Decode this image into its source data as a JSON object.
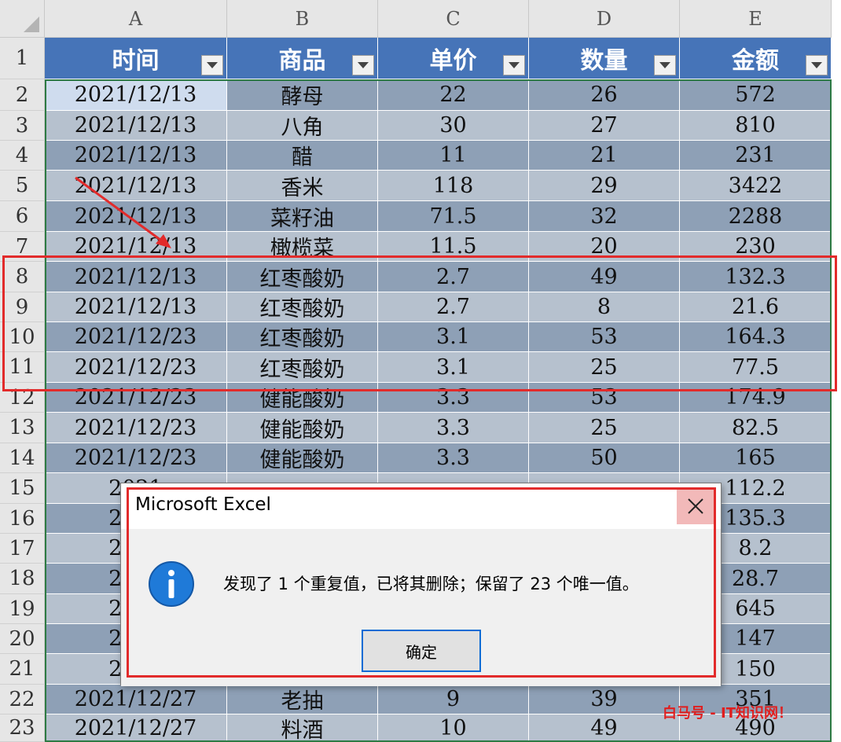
{
  "columns": [
    "A",
    "B",
    "C",
    "D",
    "E"
  ],
  "headers": [
    "时间",
    "商品",
    "单价",
    "数量",
    "金额"
  ],
  "rows": [
    {
      "num": "1"
    },
    {
      "num": "2",
      "cells": [
        "2021/12/13",
        "酵母",
        "22",
        "26",
        "572"
      ]
    },
    {
      "num": "3",
      "cells": [
        "2021/12/13",
        "八角",
        "30",
        "27",
        "810"
      ]
    },
    {
      "num": "4",
      "cells": [
        "2021/12/13",
        "醋",
        "11",
        "21",
        "231"
      ]
    },
    {
      "num": "5",
      "cells": [
        "2021/12/13",
        "香米",
        "118",
        "29",
        "3422"
      ]
    },
    {
      "num": "6",
      "cells": [
        "2021/12/13",
        "菜籽油",
        "71.5",
        "32",
        "2288"
      ]
    },
    {
      "num": "7",
      "cells": [
        "2021/12/13",
        "橄榄菜",
        "11.5",
        "20",
        "230"
      ]
    },
    {
      "num": "8",
      "cells": [
        "2021/12/13",
        "红枣酸奶",
        "2.7",
        "49",
        "132.3"
      ]
    },
    {
      "num": "9",
      "cells": [
        "2021/12/13",
        "红枣酸奶",
        "2.7",
        "8",
        "21.6"
      ]
    },
    {
      "num": "10",
      "cells": [
        "2021/12/23",
        "红枣酸奶",
        "3.1",
        "53",
        "164.3"
      ]
    },
    {
      "num": "11",
      "cells": [
        "2021/12/23",
        "红枣酸奶",
        "3.1",
        "25",
        "77.5"
      ]
    },
    {
      "num": "12",
      "cells": [
        "2021/12/23",
        "健能酸奶",
        "3.3",
        "53",
        "174.9"
      ]
    },
    {
      "num": "13",
      "cells": [
        "2021/12/23",
        "健能酸奶",
        "3.3",
        "25",
        "82.5"
      ]
    },
    {
      "num": "14",
      "cells": [
        "2021/12/23",
        "健能酸奶",
        "3.3",
        "50",
        "165"
      ]
    },
    {
      "num": "15",
      "cells": [
        "2021",
        "",
        "",
        "",
        "112.2"
      ]
    },
    {
      "num": "16",
      "cells": [
        "2021",
        "",
        "",
        "",
        "135.3"
      ]
    },
    {
      "num": "17",
      "cells": [
        "2021",
        "",
        "",
        "",
        "8.2"
      ]
    },
    {
      "num": "18",
      "cells": [
        "2021",
        "",
        "",
        "",
        "28.7"
      ]
    },
    {
      "num": "19",
      "cells": [
        "2021",
        "",
        "",
        "",
        "645"
      ]
    },
    {
      "num": "20",
      "cells": [
        "2021",
        "",
        "",
        "",
        "147"
      ]
    },
    {
      "num": "21",
      "cells": [
        "2021",
        "",
        "",
        "",
        "150"
      ]
    },
    {
      "num": "22",
      "cells": [
        "2021/12/27",
        "老抽",
        "9",
        "39",
        "351"
      ]
    },
    {
      "num": "23",
      "cells": [
        "2021/12/27",
        "料酒",
        "10",
        "49",
        "490"
      ]
    }
  ],
  "dialog": {
    "title": "Microsoft Excel",
    "message": "发现了 1 个重复值，已将其删除；保留了 23 个唯一值。",
    "ok_label": "确定",
    "icon": "info-icon"
  },
  "watermark": "白马号 - IT知识网！",
  "colors": {
    "header_blue": "#4674b8",
    "row_dark": "#8ea0b6",
    "row_light": "#b6c1ce",
    "highlight_red": "#e22b2b",
    "table_border": "#2d7a43"
  }
}
